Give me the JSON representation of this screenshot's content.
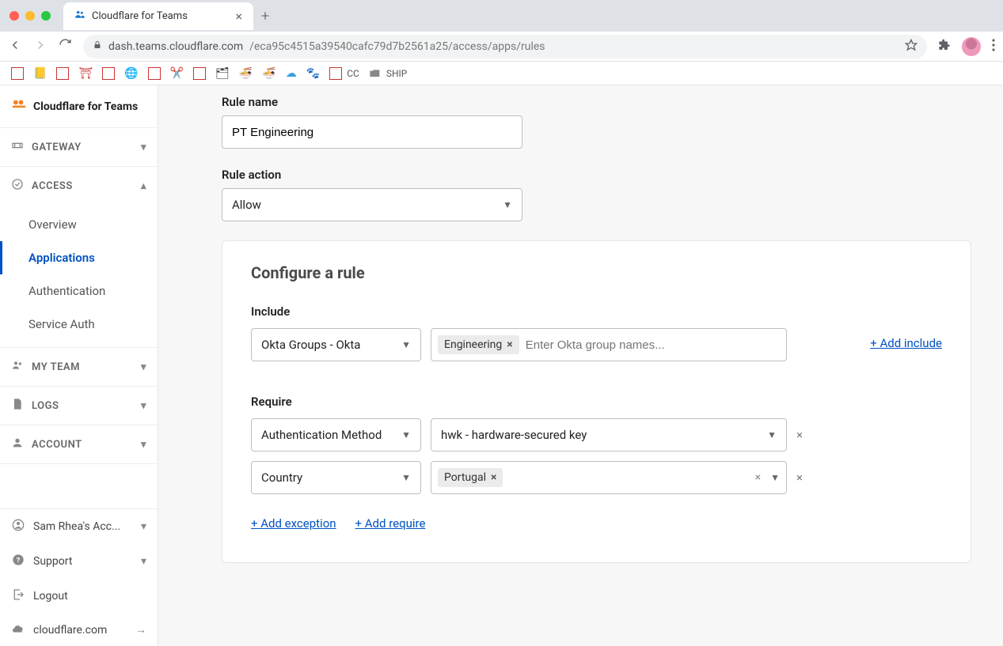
{
  "browser": {
    "tab_title": "Cloudflare for Teams",
    "url_host": "dash.teams.cloudflare.com",
    "url_path": "/eca95c4515a39540cafc79d7b2561a25/access/apps/rules",
    "bookmarks": {
      "cc": "CC",
      "ship": "SHIP"
    }
  },
  "brand": "Cloudflare for Teams",
  "sidebar": {
    "gateway": "GATEWAY",
    "access": "ACCESS",
    "access_items": [
      "Overview",
      "Applications",
      "Authentication",
      "Service Auth"
    ],
    "myteam": "MY TEAM",
    "logs": "LOGS",
    "account": "ACCOUNT",
    "acct_name": "Sam Rhea's Acc...",
    "support": "Support",
    "logout": "Logout",
    "cfsite": "cloudflare.com"
  },
  "form": {
    "rule_name_label": "Rule name",
    "rule_name_value": "PT Engineering",
    "rule_action_label": "Rule action",
    "rule_action_value": "Allow",
    "configure_title": "Configure a rule",
    "include_label": "Include",
    "include_selector": "Okta Groups - Okta",
    "include_tag": "Engineering",
    "include_placeholder": "Enter Okta group names...",
    "add_include": "+ Add include",
    "require_label": "Require",
    "require1_selector": "Authentication Method",
    "require1_value": "hwk - hardware-secured key",
    "require2_selector": "Country",
    "require2_tag": "Portugal",
    "add_exception": "+ Add exception",
    "add_require": "+ Add require"
  }
}
